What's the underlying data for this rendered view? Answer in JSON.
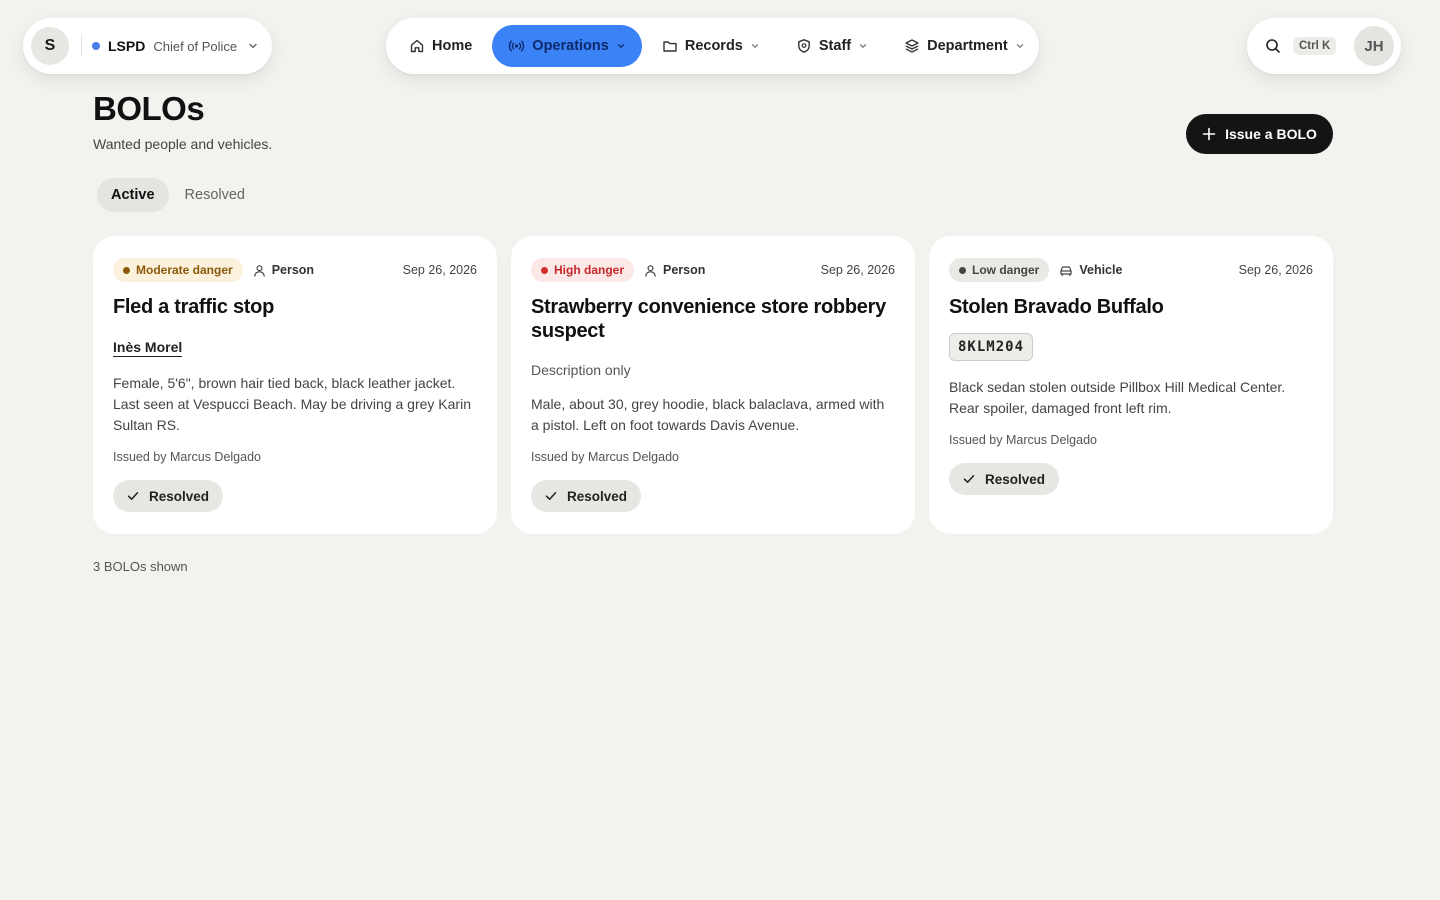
{
  "org": {
    "avatar_letter": "S",
    "name": "LSPD",
    "role": "Chief of Police",
    "status_color": "#4a7de8"
  },
  "nav": {
    "items": [
      {
        "label": "Home",
        "icon": "home-icon"
      },
      {
        "label": "Operations",
        "icon": "broadcast-icon",
        "active": true
      },
      {
        "label": "Records",
        "icon": "folder-icon"
      },
      {
        "label": "Staff",
        "icon": "shield-icon"
      },
      {
        "label": "Department",
        "icon": "layers-icon"
      }
    ],
    "active_color": "#3b82f6"
  },
  "search": {
    "icon": "search-icon",
    "shortcut": "Ctrl K"
  },
  "user": {
    "initials": "JH"
  },
  "page": {
    "title": "BOLOs",
    "subtitle": "Wanted people and vehicles.",
    "issue_button": "Issue a BOLO"
  },
  "tabs": [
    {
      "label": "Active",
      "active": true
    },
    {
      "label": "Resolved",
      "active": false
    }
  ],
  "cards": [
    {
      "danger": "Moderate danger",
      "kind": "Person",
      "kind_icon": "person-icon",
      "date": "Sep 26, 2026",
      "title": "Fled a traffic stop",
      "subject": "Inès Morel",
      "description": "Female, 5'6\", brown hair tied back, black leather jacket. Last seen at Vespucci Beach. May be driving a grey Karin Sultan RS.",
      "issued_by": "Issued by Marcus Delgado",
      "action": "Resolved"
    },
    {
      "danger": "High danger",
      "kind": "Person",
      "kind_icon": "person-icon",
      "date": "Sep 26, 2026",
      "title": "Strawberry convenience store robbery suspect",
      "subject_note": "Description only",
      "description": "Male, about 30, grey hoodie, black balaclava, armed with a pistol. Left on foot towards Davis Avenue.",
      "issued_by": "Issued by Marcus Delgado",
      "action": "Resolved"
    },
    {
      "danger": "Low danger",
      "kind": "Vehicle",
      "kind_icon": "car-icon",
      "date": "Sep 26, 2026",
      "title": "Stolen Bravado Buffalo",
      "plate": "8KLM204",
      "description": "Black sedan stolen outside Pillbox Hill Medical Center. Rear spoiler, damaged front left rim.",
      "issued_by": "Issued by Marcus Delgado",
      "action": "Resolved"
    }
  ],
  "footer": {
    "count_text": "3 BOLOs shown"
  }
}
